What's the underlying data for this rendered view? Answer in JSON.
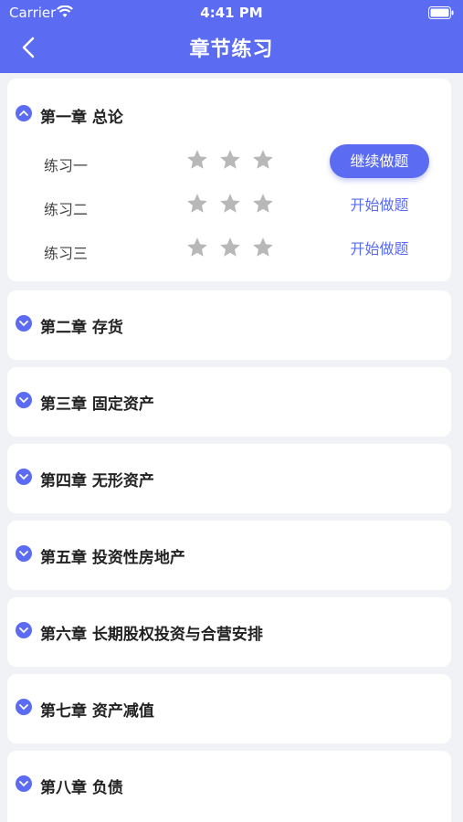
{
  "status_bar": {
    "carrier": "Carrier",
    "time": "4:41 PM"
  },
  "header": {
    "title": "章节练习",
    "back_icon": "chevron-left-icon"
  },
  "colors": {
    "accent": "#5b6cf2",
    "background": "#f1f2f6",
    "star": "#b8b8b8"
  },
  "chapters": [
    {
      "title": "第一章 总论",
      "expanded": true,
      "exercises": [
        {
          "label": "练习一",
          "stars": 0,
          "action": "继续做题",
          "action_style": "filled"
        },
        {
          "label": "练习二",
          "stars": 0,
          "action": "开始做题",
          "action_style": "text"
        },
        {
          "label": "练习三",
          "stars": 0,
          "action": "开始做题",
          "action_style": "text"
        }
      ]
    },
    {
      "title": "第二章 存货",
      "expanded": false
    },
    {
      "title": "第三章 固定资产",
      "expanded": false
    },
    {
      "title": "第四章 无形资产",
      "expanded": false
    },
    {
      "title": "第五章 投资性房地产",
      "expanded": false
    },
    {
      "title": "第六章 长期股权投资与合营安排",
      "expanded": false
    },
    {
      "title": "第七章 资产减值",
      "expanded": false
    },
    {
      "title": "第八章 负债",
      "expanded": false
    }
  ]
}
